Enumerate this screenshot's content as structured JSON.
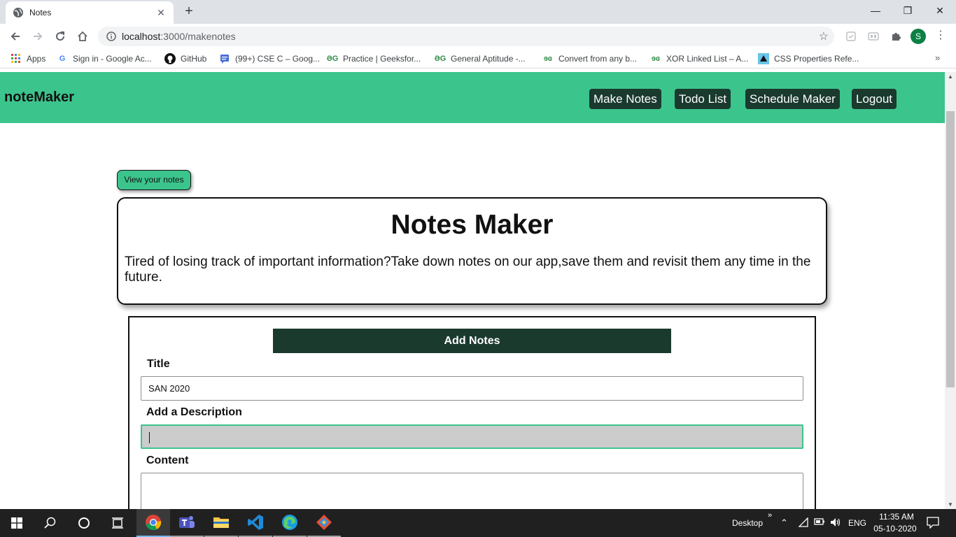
{
  "browser": {
    "tab_title": "Notes",
    "url_host": "localhost",
    "url_path": ":3000/makenotes",
    "profile_initial": "S",
    "bookmarks": [
      {
        "label": "Apps",
        "icon": "apps-grid-icon"
      },
      {
        "label": "Sign in - Google Ac...",
        "icon": "google-icon"
      },
      {
        "label": "GitHub",
        "icon": "github-icon"
      },
      {
        "label": "(99+) CSE C – Goog...",
        "icon": "google-chat-icon"
      },
      {
        "label": "Practice | Geeksfor...",
        "icon": "geeksforgeeks-icon"
      },
      {
        "label": "General Aptitude -...",
        "icon": "geeksforgeeks-icon"
      },
      {
        "label": "Convert from any b...",
        "icon": "geeksforgeeks-icon"
      },
      {
        "label": "XOR Linked List – A...",
        "icon": "geeksforgeeks-icon"
      },
      {
        "label": "CSS Properties Refe...",
        "icon": "css-reference-icon"
      }
    ]
  },
  "app": {
    "brand": "noteMaker",
    "nav": [
      "Make Notes",
      "Todo List",
      "Schedule Maker",
      "Logout"
    ],
    "view_notes_label": "View your notes",
    "hero_title": "Notes Maker",
    "hero_text": "Tired of losing track of important information?Take down notes on our app,save them and revisit them any time in the future.",
    "form": {
      "header": "Add Notes",
      "title_label": "Title",
      "title_value": "SAN 2020",
      "description_label": "Add a Description",
      "description_value": "",
      "content_label": "Content",
      "content_value": ""
    }
  },
  "taskbar": {
    "desktop_label": "Desktop",
    "language": "ENG",
    "time": "11:35 AM",
    "date": "05-10-2020"
  },
  "colors": {
    "accent_green": "#3cc48d",
    "dark_green": "#1a3a2e"
  }
}
